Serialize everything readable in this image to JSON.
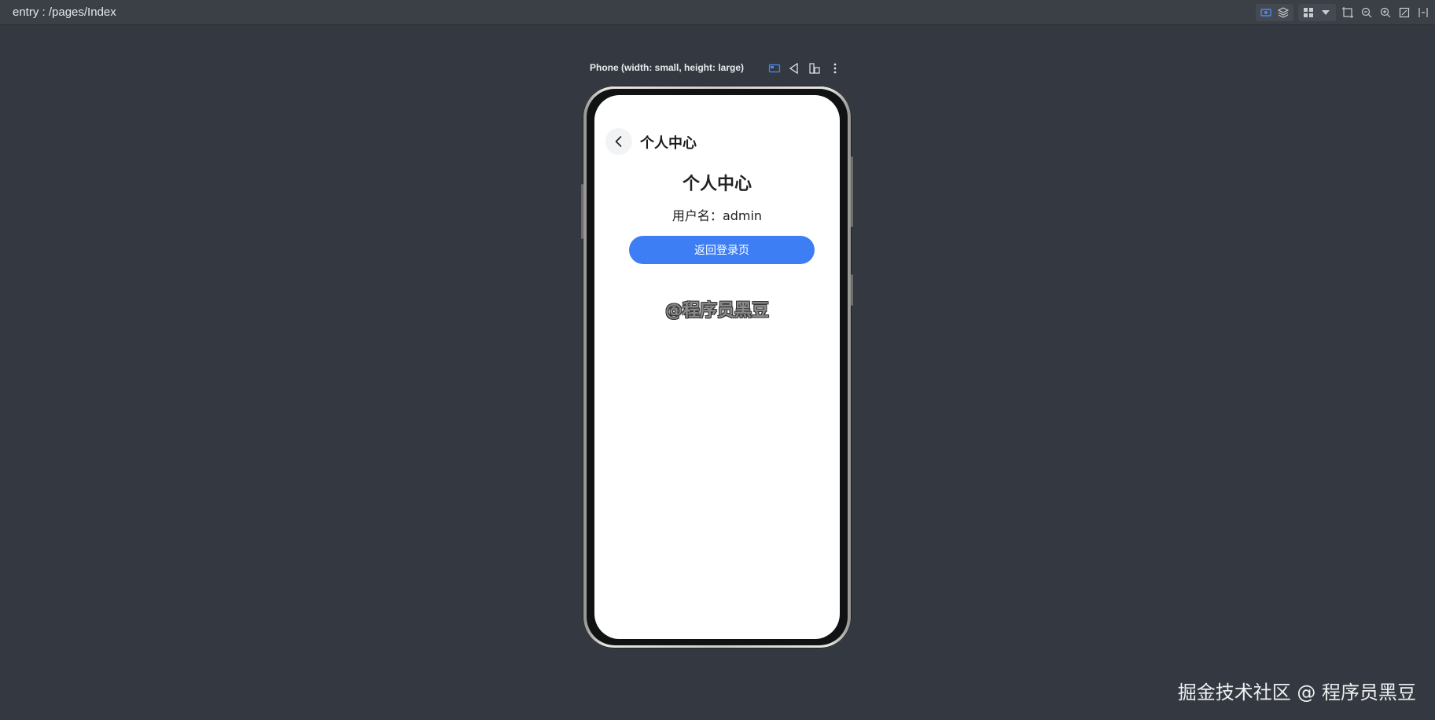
{
  "app": {
    "route": "entry : /pages/Index"
  },
  "toolbar": {
    "icons": [
      "inspector-icon",
      "layers-icon",
      "grid-icon",
      "dropdown-icon",
      "crop-icon",
      "zoom-out-icon",
      "zoom-in-icon",
      "fit-screen-icon",
      "ruler-icon"
    ],
    "accent": "#4a8af4"
  },
  "device": {
    "name": "Phone (width: small, height: large)",
    "icons": [
      "device-frame-icon",
      "rotate-icon",
      "fold-icon",
      "more-icon"
    ]
  },
  "screen": {
    "nav_title": "个人中心",
    "page_title": "个人中心",
    "username_label": "用户名：",
    "username_value": "admin",
    "return_button": "返回登录页",
    "watermark": "@程序员黑豆",
    "button_color": "#3d7ef5"
  },
  "footer": {
    "watermark": "掘金技术社区 @ 程序员黑豆"
  }
}
